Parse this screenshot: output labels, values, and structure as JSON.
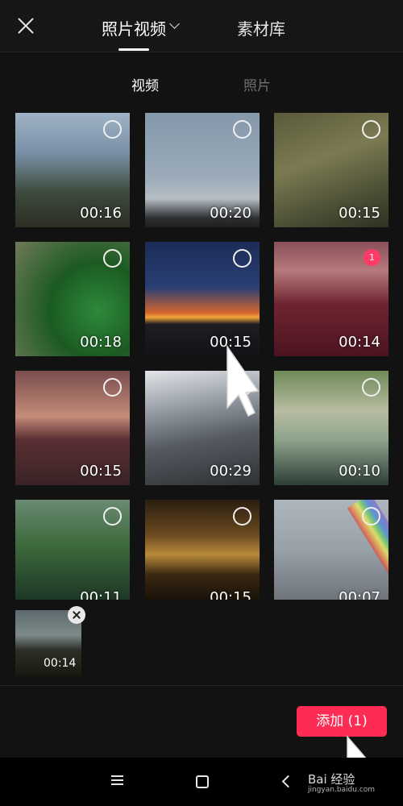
{
  "header": {
    "tab_media": "照片视频",
    "tab_library": "素材库"
  },
  "subtabs": {
    "video": "视频",
    "photo": "照片"
  },
  "grid": [
    {
      "duration": "00:16",
      "selected": false
    },
    {
      "duration": "00:20",
      "selected": false
    },
    {
      "duration": "00:15",
      "selected": false
    },
    {
      "duration": "00:18",
      "selected": false
    },
    {
      "duration": "00:15",
      "selected": false
    },
    {
      "duration": "00:14",
      "selected": true,
      "badge": "1"
    },
    {
      "duration": "00:15",
      "selected": false
    },
    {
      "duration": "00:29",
      "selected": false
    },
    {
      "duration": "00:10",
      "selected": false
    },
    {
      "duration": "00:11",
      "selected": false
    },
    {
      "duration": "00:15",
      "selected": false
    },
    {
      "duration": "00:07",
      "selected": false
    }
  ],
  "selected_clip": {
    "duration": "00:14"
  },
  "footer": {
    "add_label": "添加 (1)"
  },
  "watermark": {
    "brand": "Bai 经验",
    "url": "jingyan.baidu.com"
  },
  "colors": {
    "accent": "#fe2c55",
    "background": "#121212"
  }
}
